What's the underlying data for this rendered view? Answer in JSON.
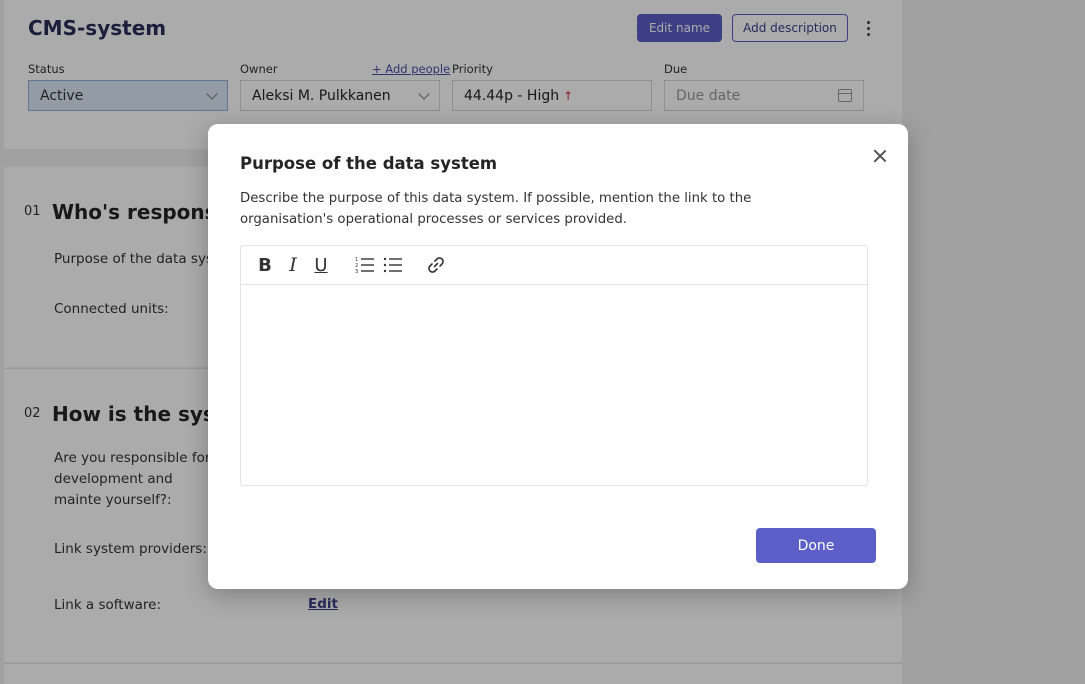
{
  "header": {
    "title": "CMS-system",
    "edit_name_label": "Edit name",
    "add_description_label": "Add description",
    "status_label": "Status",
    "status_value": "Active",
    "owner_label": "Owner",
    "add_people_label": "+ Add people",
    "owner_value": "Aleksi M. Pulkkanen",
    "priority_label": "Priority",
    "priority_value": "44.44p - High",
    "priority_arrow": "↑",
    "due_label": "Due",
    "due_placeholder": "Due date"
  },
  "sections": [
    {
      "number": "01",
      "heading": "Who's responsib",
      "rows": [
        "Purpose of the data syste",
        "Connected units:"
      ]
    },
    {
      "number": "02",
      "heading": "How is the syste",
      "rows": [
        "Are you responsible for development and mainte yourself?:",
        "Link system providers:",
        "Link a software:"
      ],
      "edit_link_label": "Edit"
    }
  ],
  "modal": {
    "title": "Purpose of the data system",
    "description": "Describe the purpose of this data system. If possible, mention the link to the organisation's operational processes or services provided.",
    "toolbar": {
      "bold": "B",
      "italic": "I",
      "underline": "U"
    },
    "done_label": "Done"
  },
  "colors": {
    "accent": "#5b5fc7",
    "status_bg": "#dce9f7",
    "priority_arrow": "#d13438"
  }
}
